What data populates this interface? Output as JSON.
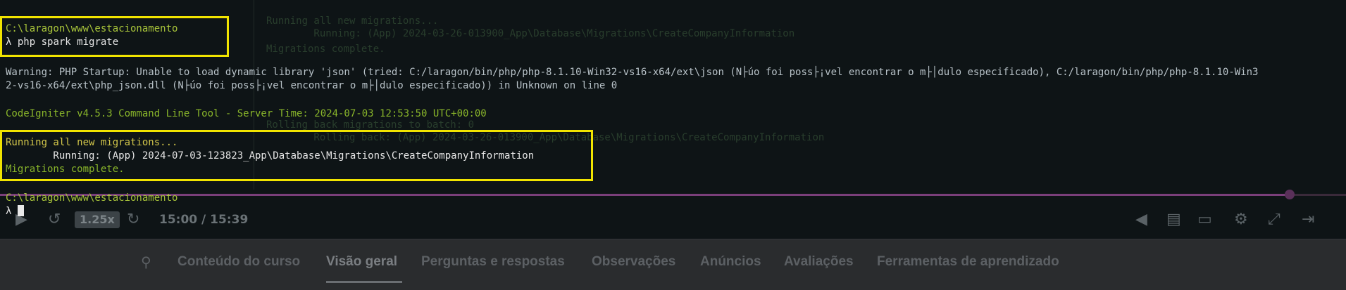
{
  "terminal": {
    "prompt_symbol": "λ",
    "block1": {
      "path": "C:\\laragon\\www\\estacionamento",
      "command": "php spark migrate"
    },
    "warning_line1": "Warning: PHP Startup: Unable to load dynamic library 'json' (tried: C:/laragon/bin/php/php-8.1.10-Win32-vs16-x64/ext\\json (N├úo foi poss├¡vel encontrar o m├│dulo especificado), C:/laragon/bin/php/php-8.1.10-Win3",
    "warning_line2": "2-vs16-x64/ext\\php_json.dll (N├úo foi poss├¡vel encontrar o m├│dulo especificado)) in Unknown on line 0",
    "codeigniter_line": "CodeIgniter v4.5.3 Command Line Tool - Server Time: 2024-07-03 12:53:50 UTC+00:00",
    "migration_running_all": "Running all new migrations...",
    "migration_running_detail": "        Running: (App) 2024-07-03-123823_App\\Database\\Migrations\\CreateCompanyInformation",
    "migration_complete": "Migrations complete.",
    "block2": {
      "path": "C:\\laragon\\www\\estacionamento"
    }
  },
  "background_code": {
    "line1": "Running all new migrations...",
    "line2": "        Running: (App) 2024-03-26-013900_App\\Database\\Migrations\\CreateCompanyInformation",
    "line3": "Migrations complete.",
    "line4": "Rolling back migrations to batch: 0",
    "line5": "        Rolling back: (App) 2024-03-26-013900_App\\Database\\Migrations\\CreateCompanyInformation"
  },
  "video_player": {
    "speed": "1.25x",
    "time": "15:00 / 15:39",
    "progress_fraction": 0.958,
    "icons": {
      "rewind": "↺",
      "forward": "↻",
      "volume": "🔈",
      "transcript": "▤",
      "captions": "▭",
      "settings": "⚙",
      "fullscreen": "⤢",
      "expand": "⇥"
    }
  },
  "course_tabs": {
    "search_icon": "⚲",
    "items": [
      {
        "label": "Conteúdo do curso"
      },
      {
        "label": "Visão geral"
      },
      {
        "label": "Perguntas e respostas"
      },
      {
        "label": "Observações"
      },
      {
        "label": "Anúncios"
      },
      {
        "label": "Avaliações"
      },
      {
        "label": "Ferramentas de aprendizado"
      }
    ],
    "active_index": 1
  },
  "colors": {
    "highlight": "#f1e400",
    "path_green": "#a8c43a",
    "info_yellow": "#d2c64a"
  }
}
